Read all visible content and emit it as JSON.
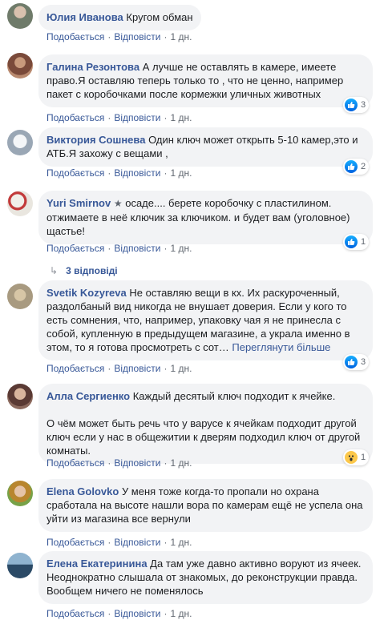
{
  "actions": {
    "like": "Подобається",
    "reply": "Відповісти",
    "time": "1 дн."
  },
  "see_more": "Переглянути більше",
  "colors": {
    "link": "#385898",
    "bubble": "#f2f3f5",
    "meta": "#606770",
    "like_blue": "#1877f2"
  },
  "comments": [
    {
      "author": "Юлия Иванова",
      "text": "Кругом обман"
    },
    {
      "author": "Галина Резонтова",
      "text": "А лучше не оставлять в камере, имеете право.Я оставляю теперь только то , что не ценно, например пакет с коробочками после кормежки уличных животных",
      "reactions": "3"
    },
    {
      "author": "Виктория Сошнева",
      "text": "Один ключ может открыть 5-10 камер,это и АТБ.Я захожу с вещами ,",
      "reactions": "2"
    },
    {
      "author": "Yuri Smirnov",
      "text": "осаде.... берете коробочку с пластилином. отжимаете в неё ключик за ключиком. и будет вам (уголовное) щастье!",
      "reactions": "1",
      "replies": "3 відповіді"
    },
    {
      "author": "Svetik Kozyreva",
      "text": "Не оставляю вещи в кх. Их раскуроченный, раздолбаный вид никогда не внушает доверия. Если у кого то есть сомнения, что, например, упаковку чая я не принесла с собой, купленную в предыдущем магазине, а украла именно в этом, то я готова просмотреть с сот…",
      "reactions": "3"
    },
    {
      "author": "Алла Сергиенко",
      "text": "Каждый десятый ключ подходит к ячейке.",
      "text2": "О чём может быть речь что у варусе к ячейкам подходит другой ключ если у нас в общежитии к дверям подходил ключ от другой комнаты.",
      "reactions": "1"
    },
    {
      "author": "Elena Golovko",
      "text": "У меня тоже когда-то пропали но охрана сработала на высоте нашли вора по камерам ещё не успела она уйти из магазина все вернули"
    },
    {
      "author": "Елена Екатеринина",
      "text": "Да там уже давно активно воруют из ячеек. Неоднократно слышала от знакомых, до реконструкции правда. Вообщем ничего не поменялось"
    }
  ]
}
